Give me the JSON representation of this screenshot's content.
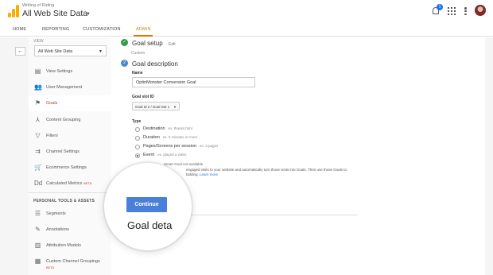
{
  "header": {
    "account_sub": "Writing of Riding",
    "account_main": "All Web Site Data",
    "notification_count": "1"
  },
  "nav": {
    "tabs": [
      {
        "label": "HOME"
      },
      {
        "label": "REPORTING"
      },
      {
        "label": "CUSTOMIZATION"
      },
      {
        "label": "ADMIN"
      }
    ],
    "active_tab": "ADMIN"
  },
  "sidebar": {
    "view_label": "VIEW",
    "view_value": "All Web Site Data",
    "items": [
      {
        "label": "View Settings",
        "icon": "document-icon"
      },
      {
        "label": "User Management",
        "icon": "users-icon"
      },
      {
        "label": "Goals",
        "icon": "flag-icon"
      },
      {
        "label": "Content Grouping",
        "icon": "grouping-icon"
      },
      {
        "label": "Filters",
        "icon": "filter-icon"
      },
      {
        "label": "Channel Settings",
        "icon": "channel-icon"
      },
      {
        "label": "Ecommerce Settings",
        "icon": "cart-icon"
      },
      {
        "label": "Calculated Metrics",
        "icon": "calculator-icon",
        "badge": "BETA"
      }
    ],
    "section_heading": "PERSONAL TOOLS & ASSETS",
    "tools": [
      {
        "label": "Segments",
        "icon": "segments-icon"
      },
      {
        "label": "Annotations",
        "icon": "annotation-icon"
      },
      {
        "label": "Attribution Models",
        "icon": "attribution-icon"
      },
      {
        "label": "Custom Channel Groupings",
        "icon": "custom-channel-icon",
        "badge": "BETA"
      }
    ]
  },
  "goal": {
    "setup_title": "Goal setup",
    "setup_edit": "Edit",
    "setup_sub": "Custom",
    "desc_step": "2",
    "desc_title": "Goal description",
    "name_label": "Name",
    "name_value": "OptinMonster Conversion Goal",
    "slot_label": "Goal slot ID",
    "slot_value": "Goal Id 2 / Goal Set 1",
    "type_label": "Type",
    "types": [
      {
        "label": "Destination",
        "example": "ex. thanks.html",
        "selected": false
      },
      {
        "label": "Duration",
        "example": "ex. 5 minutes or more",
        "selected": false
      },
      {
        "label": "Pages/Screens per session",
        "example": "ex. 3 pages",
        "selected": false
      },
      {
        "label": "Event",
        "example": "ex. played a video",
        "selected": true
      }
    ],
    "smart_goal": "Smart Goal not available",
    "smart_desc_1": "engaged visits to your website and automatically turn those visits into Goals. Then use those Goals to",
    "smart_desc_2": "bidding.",
    "learn_more": "Learn more",
    "continue": "Continue",
    "next_title": "Goal deta"
  },
  "colors": {
    "accent": "#e37400",
    "primary_button": "#4a7fd9",
    "done_step": "#2e9e44",
    "goals_active": "#c0392b"
  }
}
